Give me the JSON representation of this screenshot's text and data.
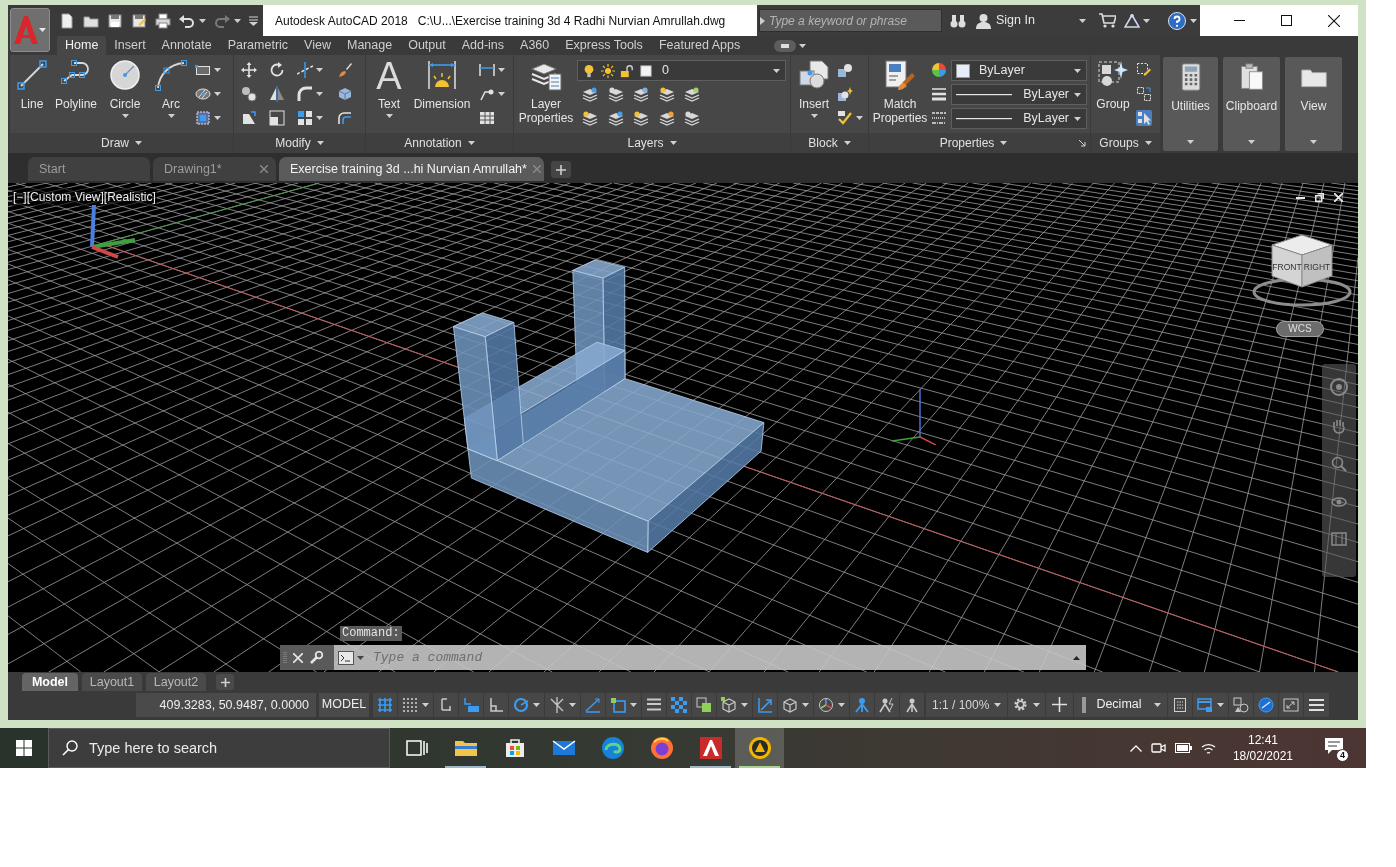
{
  "title_bar": {
    "app_name": "Autodesk AutoCAD 2018",
    "document_path": "C:\\U...\\Exercise training 3d 4 Radhi Nurvian Amrullah.dwg"
  },
  "info_center": {
    "search_placeholder": "Type a keyword or phrase",
    "sign_in": "Sign In"
  },
  "ribbon_tabs": [
    {
      "label": "Home",
      "selected": true
    },
    {
      "label": "Insert",
      "selected": false
    },
    {
      "label": "Annotate",
      "selected": false
    },
    {
      "label": "Parametric",
      "selected": false
    },
    {
      "label": "View",
      "selected": false
    },
    {
      "label": "Manage",
      "selected": false
    },
    {
      "label": "Output",
      "selected": false
    },
    {
      "label": "Add-ins",
      "selected": false
    },
    {
      "label": "A360",
      "selected": false
    },
    {
      "label": "Express Tools",
      "selected": false
    },
    {
      "label": "Featured Apps",
      "selected": false
    }
  ],
  "ribbon_panels": [
    {
      "kind": "draw",
      "title": "Draw",
      "buttons": [
        "Line",
        "Polyline",
        "Circle",
        "Arc"
      ]
    },
    {
      "kind": "modify",
      "title": "Modify"
    },
    {
      "kind": "annotation",
      "title": "Annotation",
      "text_glyph": "A",
      "buttons": [
        "Text",
        "Dimension"
      ]
    },
    {
      "kind": "layers",
      "title": "Layers",
      "buttons": [
        "Layer Properties"
      ],
      "current_layer": "0"
    },
    {
      "kind": "block",
      "title": "Block",
      "buttons": [
        "Insert"
      ]
    },
    {
      "kind": "properties",
      "title": "Properties",
      "buttons": [
        "Match Properties"
      ],
      "color_setting": "ByLayer",
      "linetype": "ByLayer",
      "lineweight": "ByLayer"
    },
    {
      "kind": "groups",
      "title": "Groups",
      "buttons": [
        "Group"
      ],
      "group_selection": true
    },
    {
      "kind": "utilities",
      "title": "Utilities"
    },
    {
      "kind": "clipboard",
      "title": "Clipboard"
    },
    {
      "kind": "view",
      "title": "View"
    }
  ],
  "file_tabs": [
    {
      "label": "Start",
      "selected": false,
      "closable": false
    },
    {
      "label": "Drawing1*",
      "selected": false,
      "closable": true
    },
    {
      "label": "Exercise training 3d ...hi Nurvian Amrullah*",
      "selected": true,
      "closable": true
    }
  ],
  "viewport": {
    "view_controls": "[−][Custom View][Realistic]",
    "viewcube_faces": [
      "FRONT",
      "RIGHT"
    ],
    "wcs_menu": "WCS"
  },
  "command_line": {
    "history": "Command:",
    "placeholder": "Type a command"
  },
  "layout_tabs": [
    {
      "label": "Model",
      "selected": true
    },
    {
      "label": "Layout1",
      "selected": false
    },
    {
      "label": "Layout2",
      "selected": false
    }
  ],
  "status_bar": {
    "coordinates": "409.3283, 50.9487, 0.0000",
    "space": "MODEL",
    "toggles": [
      {
        "kind": "grid",
        "on": true
      },
      {
        "kind": "snap",
        "on": false
      },
      {
        "kind": "infer",
        "on": false
      },
      {
        "kind": "dynamic_input",
        "on": true
      },
      {
        "kind": "ortho",
        "on": false
      },
      {
        "kind": "polar",
        "on": true
      },
      {
        "kind": "isodraft",
        "on": false
      },
      {
        "kind": "osnap_tracking",
        "on": true
      },
      {
        "kind": "osnap",
        "on": true
      },
      {
        "kind": "lineweight",
        "on": false
      },
      {
        "kind": "transparency",
        "on": true
      },
      {
        "kind": "selection_cycling",
        "on": false
      },
      {
        "kind": "osnap_3d",
        "on": false
      },
      {
        "kind": "dynamic_ucs",
        "on": true
      },
      {
        "kind": "selection_filter",
        "on": false
      },
      {
        "kind": "gizmo",
        "on": false
      },
      {
        "kind": "annotation_visibility",
        "on": true
      },
      {
        "kind": "autoscale",
        "on": false
      },
      {
        "kind": "annotation_scale",
        "on": false
      }
    ],
    "annotation_scale": "1:1 / 100%",
    "units": "Decimal",
    "tool_toggles": [
      {
        "kind": "lock_ui",
        "on": true
      },
      {
        "kind": "isolate",
        "on": false
      },
      {
        "kind": "hardware_acceleration",
        "on": true
      },
      {
        "kind": "clean_screen",
        "on": false
      }
    ]
  },
  "taskbar": {
    "search_placeholder": "Type here to search",
    "apps": [
      {
        "kind": "task_view",
        "running": false,
        "active": false
      },
      {
        "kind": "file_explorer",
        "running": true,
        "active": false
      },
      {
        "kind": "store",
        "running": false,
        "active": false
      },
      {
        "kind": "mail",
        "running": false,
        "active": false
      },
      {
        "kind": "edge",
        "running": false,
        "active": false
      },
      {
        "kind": "firefox",
        "running": false,
        "active": false
      },
      {
        "kind": "autocad",
        "running": true,
        "active": false
      },
      {
        "kind": "autodesk_app",
        "running": true,
        "active": true
      }
    ],
    "time": "12:41",
    "date": "18/02/2021",
    "notification_count": "4"
  }
}
